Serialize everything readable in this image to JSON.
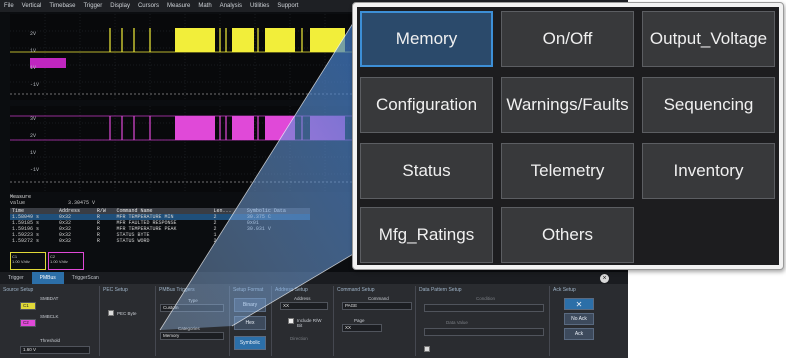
{
  "menubar": {
    "items": [
      "File",
      "Vertical",
      "Timebase",
      "Trigger",
      "Display",
      "Cursors",
      "Measure",
      "Math",
      "Analysis",
      "Utilities",
      "Support"
    ]
  },
  "scope": {
    "scale_labels_top": [
      "2V",
      "1V",
      "1V",
      "-1V"
    ],
    "scale_labels_bottom": [
      "3V",
      "2V",
      "1V",
      "-1V"
    ],
    "measure_title": "Measure",
    "measure_rows": [
      {
        "label": "value",
        "value": "3.30475 V"
      },
      {
        "label": "status",
        "value": ""
      }
    ],
    "table_headers": [
      "Time",
      "Address",
      "R/W",
      "Command Name",
      "Len...",
      "Symbolic Data"
    ],
    "table_rows": [
      [
        "1.58049 s",
        "0x32",
        "R",
        "MFR TEMPERATURE MIN",
        "2",
        "30.375 C"
      ],
      [
        "1.59185 s",
        "0x32",
        "R",
        "MFR FAULTED RESPONSE",
        "2",
        "0x01"
      ],
      [
        "1.59196 s",
        "0x32",
        "R",
        "MFR TEMPERATURE PEAK",
        "2",
        "30.031 V"
      ],
      [
        "1.59223 s",
        "0x32",
        "R",
        "STATUS BYTE",
        "1",
        ""
      ],
      [
        "1.59272 s",
        "0x32",
        "R",
        "STATUS WORD",
        "2",
        ""
      ]
    ],
    "channels": [
      {
        "label": "C1",
        "value": "1.00 V/div"
      },
      {
        "label": "C2",
        "value": "1.00 V/div"
      }
    ]
  },
  "dialog": {
    "tabs": [
      "Trigger",
      "PMBus",
      "TriggerScan"
    ],
    "active_tab": "PMBus",
    "groups": {
      "source_setup": {
        "title": "Source Setup",
        "smbdat": "SMBDAT",
        "smbclk": "SMBCLK",
        "c1": "C1",
        "c2": "C2",
        "threshold_label": "Threshold",
        "threshold_value": "1.60 V"
      },
      "pec_setup": {
        "title": "PEC Setup",
        "pec_byte": "PEC Byte"
      },
      "pmbus_triggers": {
        "title": "PMBus Triggers",
        "type_label": "Type",
        "type_value": "Custom",
        "categories_label": "Categories",
        "categories_value": "Memory"
      },
      "setup_format": {
        "title": "Setup Format",
        "binary": "Binary",
        "hex": "Hex",
        "symbolic": "Symbolic"
      },
      "address_setup": {
        "title": "Address Setup",
        "address_label": "Address",
        "address_value": "XX",
        "include_rw": "Include R/W Bit",
        "direction_label": "Direction"
      },
      "command_setup": {
        "title": "Command Setup",
        "command_label": "Command",
        "command_value": "PAGE",
        "page_label": "Page",
        "page_value": "XX"
      },
      "data_pattern_setup": {
        "title": "Data Pattern Setup",
        "condition_label": "Condition",
        "data_value_label": "Data Value"
      },
      "ack_setup": {
        "title": "Ack Setup",
        "no_ack": "No Ack",
        "ack": "Ack"
      }
    }
  },
  "command_panel": {
    "buttons": [
      "Memory",
      "On/Off",
      "Output_Voltage",
      "Configuration",
      "Warnings/Faults",
      "Sequencing",
      "Status",
      "Telemetry",
      "Inventory",
      "Mfg_Ratings",
      "Others"
    ],
    "selected": "Memory"
  }
}
